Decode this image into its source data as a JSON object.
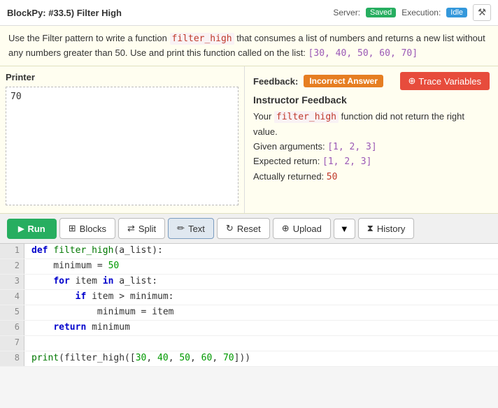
{
  "header": {
    "title": "BlockPy: #33.5) Filter High",
    "server_label": "Server:",
    "server_badge": "Saved",
    "execution_label": "Execution:",
    "execution_badge": "Idle"
  },
  "description": {
    "text_before": "Use the Filter pattern to write a function",
    "code_filter_high": "filter_high",
    "text_after": "that consumes a list of numbers and returns a new list without any numbers greater than 50. Use and print this function called on the list:",
    "list_code": "[30, 40, 50, 60, 70]"
  },
  "printer": {
    "title": "Printer",
    "output": "70"
  },
  "feedback": {
    "label": "Feedback:",
    "badge": "Incorrect Answer",
    "trace_btn": "Trace Variables",
    "instructor_title": "Instructor Feedback",
    "text1": "Your",
    "code_fn": "filter_high",
    "text2": "function did not return the right value.",
    "given_args_label": "Given arguments:",
    "given_args_code": "[1, 2, 3]",
    "expected_label": "Expected return:",
    "expected_code": "[1, 2, 3]",
    "returned_label": "Actually returned:",
    "returned_code": "50"
  },
  "toolbar": {
    "run_label": "Run",
    "blocks_label": "Blocks",
    "split_label": "Split",
    "text_label": "Text",
    "reset_label": "Reset",
    "upload_label": "Upload",
    "history_label": "History"
  },
  "code": {
    "lines": [
      {
        "num": 1,
        "content": "def filter_high(a_list):",
        "tokens": [
          {
            "t": "kw",
            "v": "def"
          },
          {
            "t": "",
            "v": " "
          },
          {
            "t": "fn",
            "v": "filter_high"
          },
          {
            "t": "",
            "v": "(a_list):"
          }
        ]
      },
      {
        "num": 2,
        "content": "    minimum = 50",
        "tokens": [
          {
            "t": "",
            "v": "    minimum = "
          },
          {
            "t": "num",
            "v": "50"
          }
        ]
      },
      {
        "num": 3,
        "content": "    for item in a_list:",
        "tokens": [
          {
            "t": "",
            "v": "    "
          },
          {
            "t": "kw",
            "v": "for"
          },
          {
            "t": "",
            "v": " item "
          },
          {
            "t": "kw",
            "v": "in"
          },
          {
            "t": "",
            "v": " a_list:"
          }
        ]
      },
      {
        "num": 4,
        "content": "        if item > minimum:",
        "tokens": [
          {
            "t": "",
            "v": "        "
          },
          {
            "t": "kw",
            "v": "if"
          },
          {
            "t": "",
            "v": " item > minimum:"
          }
        ]
      },
      {
        "num": 5,
        "content": "            minimum = item",
        "tokens": [
          {
            "t": "",
            "v": "            minimum = item"
          }
        ]
      },
      {
        "num": 6,
        "content": "    return minimum",
        "tokens": [
          {
            "t": "",
            "v": "    "
          },
          {
            "t": "kw",
            "v": "return"
          },
          {
            "t": "",
            "v": " minimum"
          }
        ]
      },
      {
        "num": 7,
        "content": "",
        "tokens": []
      },
      {
        "num": 8,
        "content": "print(filter_high([30, 40, 50, 60, 70]))",
        "tokens": [
          {
            "t": "fn",
            "v": "print"
          },
          {
            "t": "",
            "v": "(filter_high(["
          },
          {
            "t": "num",
            "v": "30"
          },
          {
            "t": "",
            "v": ", "
          },
          {
            "t": "num",
            "v": "40"
          },
          {
            "t": "",
            "v": ", "
          },
          {
            "t": "num",
            "v": "50"
          },
          {
            "t": "",
            "v": ", "
          },
          {
            "t": "num",
            "v": "60"
          },
          {
            "t": "",
            "v": ", "
          },
          {
            "t": "num",
            "v": "70"
          },
          {
            "t": "",
            "v": "]))"
          }
        ]
      }
    ]
  }
}
